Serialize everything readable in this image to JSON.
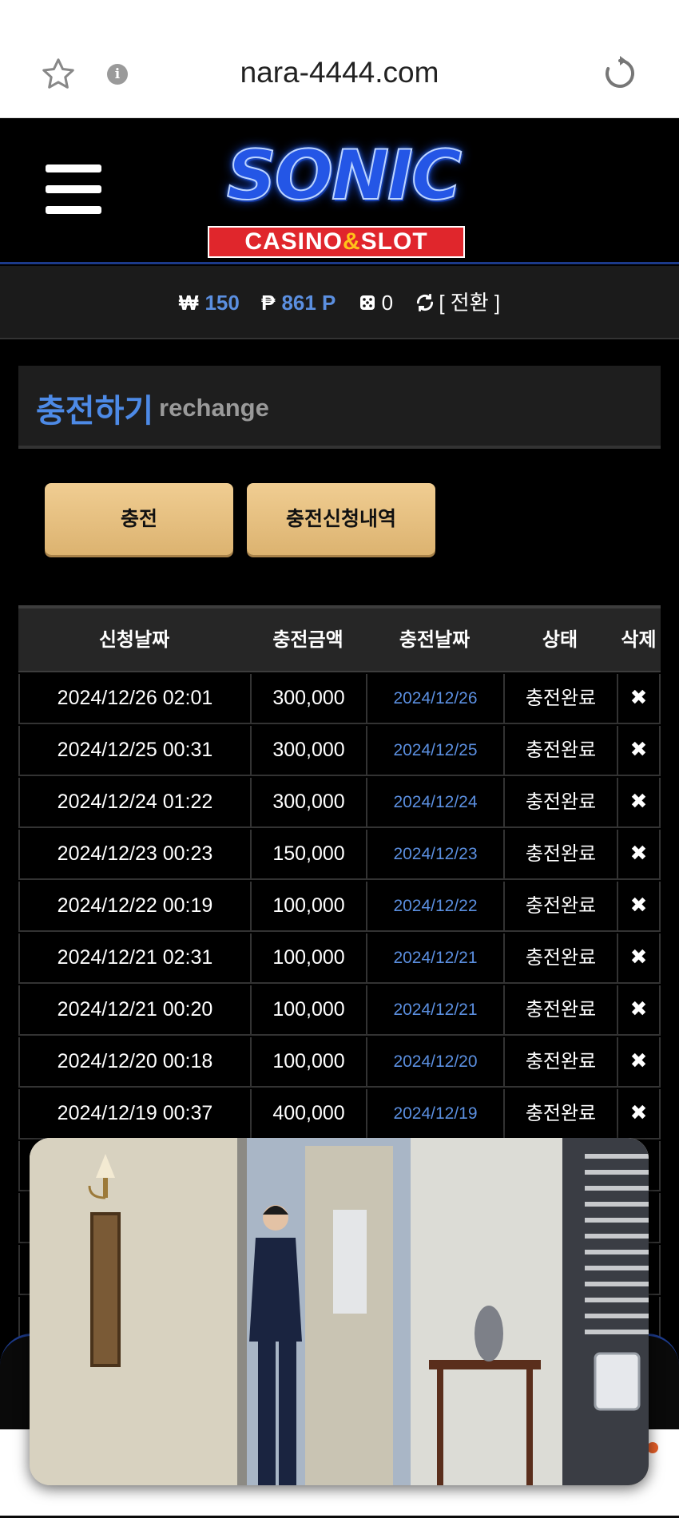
{
  "browser": {
    "url": "nara-4444.com"
  },
  "logo": {
    "word": "SONIC",
    "sub_before": "CASINO",
    "sub_amp": "&",
    "sub_after": "SLOT"
  },
  "balance": {
    "won_symbol": "₩",
    "won_value": "150",
    "point_symbol": "₱",
    "point_value": "861 P",
    "chip_value": "0",
    "convert_label": "[ 전환 ]"
  },
  "section": {
    "title_ko": "충전하기",
    "title_en": "rechange"
  },
  "buttons": {
    "charge": "충전",
    "history": "충전신청내역"
  },
  "table": {
    "headers": [
      "신청날짜",
      "충전금액",
      "충전날짜",
      "상태",
      "삭제"
    ],
    "rows": [
      {
        "request": "2024/12/26 02:01",
        "amount": "300,000",
        "charged": "2024/12/26",
        "status": "충전완료",
        "del": "✖"
      },
      {
        "request": "2024/12/25 00:31",
        "amount": "300,000",
        "charged": "2024/12/25",
        "status": "충전완료",
        "del": "✖"
      },
      {
        "request": "2024/12/24 01:22",
        "amount": "300,000",
        "charged": "2024/12/24",
        "status": "충전완료",
        "del": "✖"
      },
      {
        "request": "2024/12/23 00:23",
        "amount": "150,000",
        "charged": "2024/12/23",
        "status": "충전완료",
        "del": "✖"
      },
      {
        "request": "2024/12/22 00:19",
        "amount": "100,000",
        "charged": "2024/12/22",
        "status": "충전완료",
        "del": "✖"
      },
      {
        "request": "2024/12/21 02:31",
        "amount": "100,000",
        "charged": "2024/12/21",
        "status": "충전완료",
        "del": "✖"
      },
      {
        "request": "2024/12/21 00:20",
        "amount": "100,000",
        "charged": "2024/12/21",
        "status": "충전완료",
        "del": "✖"
      },
      {
        "request": "2024/12/20 00:18",
        "amount": "100,000",
        "charged": "2024/12/20",
        "status": "충전완료",
        "del": "✖"
      },
      {
        "request": "2024/12/19 00:37",
        "amount": "400,000",
        "charged": "2024/12/19",
        "status": "충전완료",
        "del": "✖"
      },
      {
        "request": "",
        "amount": "",
        "charged": "",
        "status": "",
        "del": ""
      },
      {
        "request": "",
        "amount": "",
        "charged": "",
        "status": "",
        "del": ""
      },
      {
        "request": "",
        "amount": "",
        "charged": "",
        "status": "",
        "del": ""
      },
      {
        "request": "",
        "amount": "",
        "charged": "",
        "status": "",
        "del": ""
      }
    ]
  },
  "colors": {
    "accent_blue": "#4d8ae6",
    "button_gold": "#e4be7e",
    "logo_red": "#e0262c"
  },
  "icons": [
    "star-icon",
    "info-icon",
    "reload-icon",
    "menu-icon",
    "refresh-icon",
    "dice-icon",
    "close-icon"
  ]
}
